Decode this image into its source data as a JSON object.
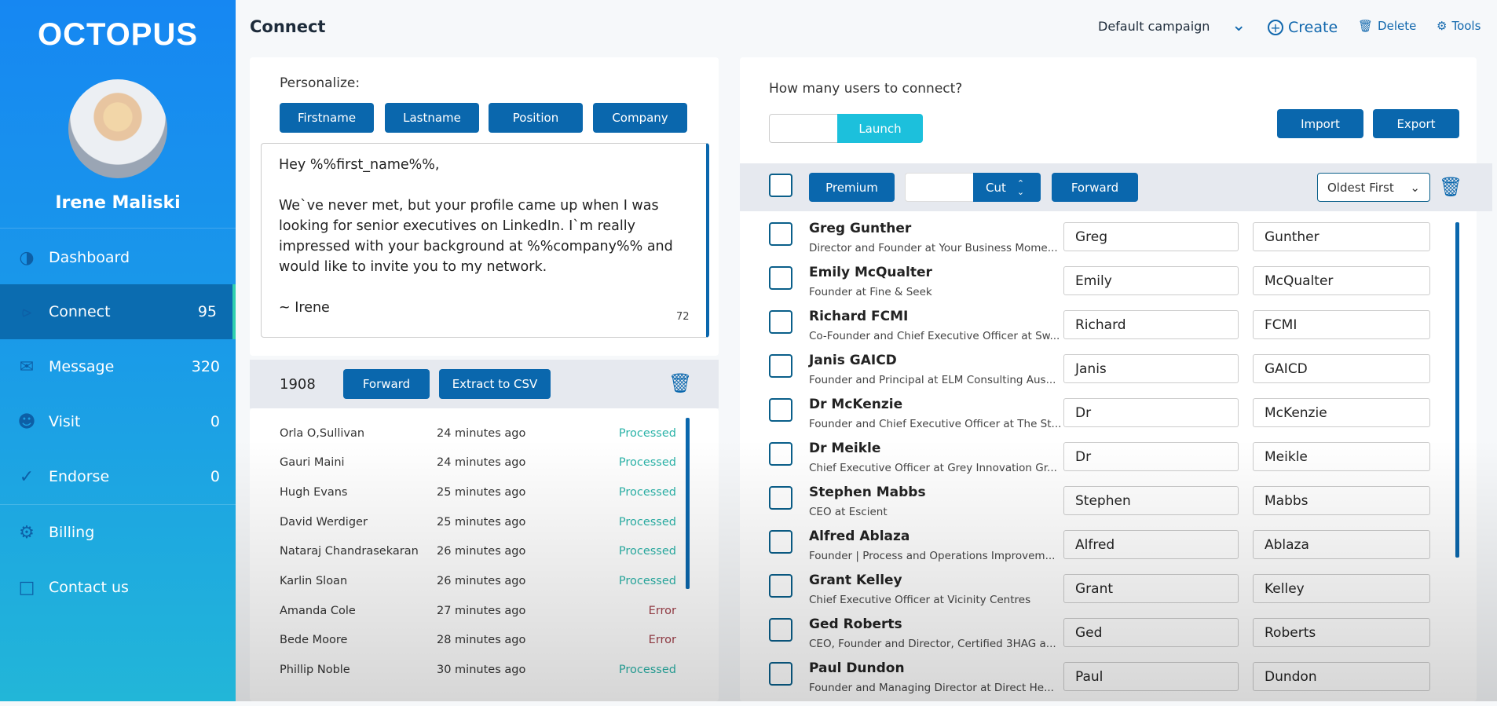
{
  "app": {
    "logo": "OCTOPUS",
    "user_name": "Irene Maliski"
  },
  "sidebar": {
    "items": [
      {
        "label": "Dashboard",
        "count": null,
        "icon": "dashboard-icon"
      },
      {
        "label": "Connect",
        "count": "95",
        "icon": "share-icon",
        "active": true
      },
      {
        "label": "Message",
        "count": "320",
        "icon": "mail-icon"
      },
      {
        "label": "Visit",
        "count": "0",
        "icon": "users-icon"
      },
      {
        "label": "Endorse",
        "count": "0",
        "icon": "user-check-icon"
      },
      {
        "label": "Billing",
        "count": null,
        "icon": "gear-icon"
      },
      {
        "label": "Contact us",
        "count": null,
        "icon": "chat-icon"
      }
    ]
  },
  "header": {
    "title": "Connect",
    "campaign": "Default campaign",
    "create": "Create",
    "delete": "Delete",
    "tools": "Tools"
  },
  "message": {
    "personalize_label": "Personalize:",
    "buttons": [
      "Firstname",
      "Lastname",
      "Position",
      "Company"
    ],
    "text": "Hey %%first_name%%,\n\nWe`ve never met, but your profile came up when I was looking for senior executives on LinkedIn. I`m really impressed with your background at %%company%% and would like to invite you to my network.\n\n~ Irene",
    "char_count": "72"
  },
  "queue": {
    "count": "1908",
    "forward": "Forward",
    "extract": "Extract to CSV",
    "rows": [
      {
        "name": "Orla O,Sullivan",
        "time": "24 minutes ago",
        "status": "Processed"
      },
      {
        "name": "Gauri Maini",
        "time": "24 minutes ago",
        "status": "Processed"
      },
      {
        "name": "Hugh Evans",
        "time": "25 minutes ago",
        "status": "Processed"
      },
      {
        "name": "David Werdiger",
        "time": "25 minutes ago",
        "status": "Processed"
      },
      {
        "name": "Nataraj Chandrasekaran",
        "time": "26 minutes ago",
        "status": "Processed"
      },
      {
        "name": "Karlin Sloan",
        "time": "26 minutes ago",
        "status": "Processed"
      },
      {
        "name": "Amanda Cole",
        "time": "27 minutes ago",
        "status": "Error"
      },
      {
        "name": "Bede Moore",
        "time": "28 minutes ago",
        "status": "Error"
      },
      {
        "name": "Phillip Noble",
        "time": "30 minutes ago",
        "status": "Processed"
      }
    ]
  },
  "colors": {
    "processed": "#2bb3a8",
    "error": "#a0404a",
    "accent": "#0a67ad",
    "launch": "#1cc0dc"
  },
  "connect": {
    "question": "How many users to connect?",
    "count_value": "",
    "launch": "Launch",
    "import": "Import",
    "export": "Export",
    "premium": "Premium",
    "cut_value": "",
    "cut": "Cut",
    "forward": "Forward",
    "sort": "Oldest First",
    "people": [
      {
        "name": "Greg Gunther",
        "title": "Director and Founder at Your Business Mome...",
        "first": "Greg",
        "last": "Gunther"
      },
      {
        "name": "Emily McQualter",
        "title": "Founder at Fine & Seek",
        "first": "Emily",
        "last": "McQualter"
      },
      {
        "name": "Richard FCMI",
        "title": "Co-Founder and Chief Executive Officer at Sw...",
        "first": "Richard",
        "last": "FCMI"
      },
      {
        "name": "Janis GAICD",
        "title": "Founder and Principal at ELM Consulting Aus...",
        "first": "Janis",
        "last": "GAICD"
      },
      {
        "name": "Dr McKenzie",
        "title": "Founder and Chief Executive Officer at The St...",
        "first": "Dr",
        "last": "McKenzie"
      },
      {
        "name": "Dr Meikle",
        "title": "Chief Executive Officer at Grey Innovation Gr...",
        "first": "Dr",
        "last": "Meikle"
      },
      {
        "name": "Stephen Mabbs",
        "title": "CEO at Escient",
        "first": "Stephen",
        "last": "Mabbs"
      },
      {
        "name": "Alfred Ablaza",
        "title": "Founder | Process and Operations Improvem...",
        "first": "Alfred",
        "last": "Ablaza"
      },
      {
        "name": "Grant Kelley",
        "title": "Chief Executive Officer at Vicinity Centres",
        "first": "Grant",
        "last": "Kelley"
      },
      {
        "name": "Ged Roberts",
        "title": "CEO, Founder and Director, Certified 3HAG a...",
        "first": "Ged",
        "last": "Roberts"
      },
      {
        "name": "Paul Dundon",
        "title": "Founder and Managing Director at Direct He...",
        "first": "Paul",
        "last": "Dundon"
      }
    ]
  }
}
